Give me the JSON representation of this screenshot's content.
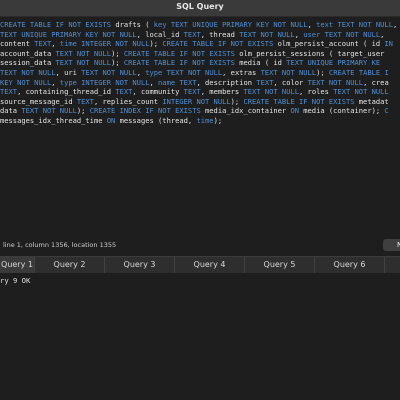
{
  "window": {
    "title": "SQL Query"
  },
  "editor": {
    "lines": [
      [
        [
          "k",
          "CREATE TABLE IF NOT EXISTS"
        ],
        [
          "t",
          " drafts ( "
        ],
        [
          "k",
          "key"
        ],
        [
          "t",
          " "
        ],
        [
          "k",
          "TEXT UNIQUE PRIMARY KEY NOT NULL"
        ],
        [
          "t",
          ", "
        ],
        [
          "k",
          "text"
        ],
        [
          "t",
          " "
        ],
        [
          "k",
          "TEXT NOT NULL"
        ],
        [
          "t",
          ","
        ]
      ],
      [
        [
          "k",
          "TEXT UNIQUE PRIMARY KEY NOT NULL"
        ],
        [
          "t",
          ", local_id "
        ],
        [
          "k",
          "TEXT"
        ],
        [
          "t",
          ", thread "
        ],
        [
          "k",
          "TEXT NOT NULL"
        ],
        [
          "t",
          ", "
        ],
        [
          "k",
          "user"
        ],
        [
          "t",
          " "
        ],
        [
          "k",
          "TEXT NOT NULL"
        ],
        [
          "t",
          ","
        ]
      ],
      [
        [
          "t",
          "content "
        ],
        [
          "k",
          "TEXT"
        ],
        [
          "t",
          ", "
        ],
        [
          "k",
          "time INTEGER NOT NULL"
        ],
        [
          "t",
          "); "
        ],
        [
          "k",
          "CREATE TABLE IF NOT EXISTS"
        ],
        [
          "t",
          " olm_persist_account ( id "
        ],
        [
          "k",
          "IN"
        ]
      ],
      [
        [
          "t",
          "account_data "
        ],
        [
          "k",
          "TEXT NOT NULL"
        ],
        [
          "t",
          "); "
        ],
        [
          "k",
          "CREATE TABLE IF NOT EXISTS"
        ],
        [
          "t",
          " olm_persist_sessions ( target_user"
        ]
      ],
      [
        [
          "t",
          "session_data "
        ],
        [
          "k",
          "TEXT NOT NULL"
        ],
        [
          "t",
          "); "
        ],
        [
          "k",
          "CREATE TABLE IF NOT EXISTS"
        ],
        [
          "t",
          " media ( id "
        ],
        [
          "k",
          "TEXT UNIQUE PRIMARY KE"
        ]
      ],
      [
        [
          "k",
          "TEXT NOT NULL"
        ],
        [
          "t",
          ", uri "
        ],
        [
          "k",
          "TEXT NOT NULL"
        ],
        [
          "t",
          ", "
        ],
        [
          "k",
          "type"
        ],
        [
          "t",
          " "
        ],
        [
          "k",
          "TEXT NOT NULL"
        ],
        [
          "t",
          ", extras "
        ],
        [
          "k",
          "TEXT NOT NULL"
        ],
        [
          "t",
          "); "
        ],
        [
          "k",
          "CREATE TABLE I"
        ]
      ],
      [
        [
          "k",
          "KEY NOT NULL"
        ],
        [
          "t",
          ", "
        ],
        [
          "k",
          "type INTEGER NOT NULL"
        ],
        [
          "t",
          ", "
        ],
        [
          "k",
          "name"
        ],
        [
          "t",
          " "
        ],
        [
          "k",
          "TEXT"
        ],
        [
          "t",
          ", description "
        ],
        [
          "k",
          "TEXT"
        ],
        [
          "t",
          ", color "
        ],
        [
          "k",
          "TEXT NOT NULL"
        ],
        [
          "t",
          ", crea"
        ]
      ],
      [
        [
          "k",
          "TEXT"
        ],
        [
          "t",
          ", containing_thread_id "
        ],
        [
          "k",
          "TEXT"
        ],
        [
          "t",
          ", community "
        ],
        [
          "k",
          "TEXT"
        ],
        [
          "t",
          ", members "
        ],
        [
          "k",
          "TEXT NOT NULL"
        ],
        [
          "t",
          ", roles "
        ],
        [
          "k",
          "TEXT NOT NULL"
        ]
      ],
      [
        [
          "t",
          "source_message_id "
        ],
        [
          "k",
          "TEXT"
        ],
        [
          "t",
          ", replies_count "
        ],
        [
          "k",
          "INTEGER NOT NULL"
        ],
        [
          "t",
          "); "
        ],
        [
          "k",
          "CREATE TABLE IF NOT EXISTS"
        ],
        [
          "t",
          " metadat"
        ]
      ],
      [
        [
          "t",
          "data "
        ],
        [
          "k",
          "TEXT NOT NULL"
        ],
        [
          "t",
          "); "
        ],
        [
          "k",
          "CREATE INDEX IF NOT EXISTS"
        ],
        [
          "t",
          " media_idx_container "
        ],
        [
          "k",
          "ON"
        ],
        [
          "t",
          " media (container); "
        ],
        [
          "k",
          "C"
        ]
      ],
      [
        [
          "t",
          "messages_idx_thread_time "
        ],
        [
          "k",
          "ON"
        ],
        [
          "t",
          " messages (thread, "
        ],
        [
          "k",
          "time"
        ],
        [
          "t",
          ");"
        ]
      ]
    ]
  },
  "status": {
    "cursor": "line 1, column 1356, location 1355"
  },
  "toolbar": {
    "run_label": "N"
  },
  "tabs": [
    "Query 1",
    "Query 2",
    "Query 3",
    "Query 4",
    "Query 5",
    "Query 6"
  ],
  "results": {
    "line": "ry 9 OK"
  },
  "colors": {
    "keyword": "#4f8fd6",
    "background": "#1e1e1e"
  }
}
